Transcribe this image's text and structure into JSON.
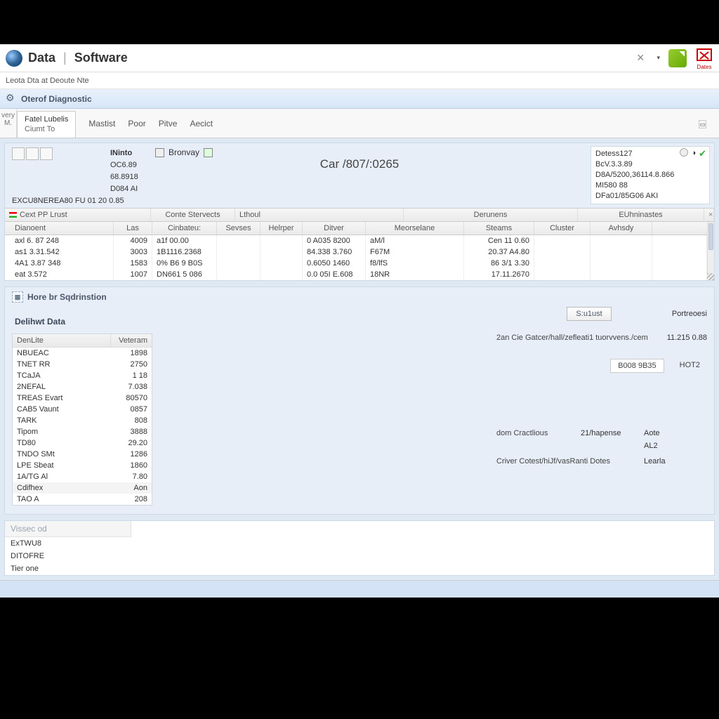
{
  "titlebar": {
    "app_a": "Data",
    "app_b": "Software",
    "badge_label": "Dates"
  },
  "subtitle": "Leota Dta at Deoute Nte",
  "section": {
    "title": "Oterof Diagnostic"
  },
  "side_stub": {
    "l1": "very",
    "l2": "M."
  },
  "tab": {
    "line1": "Fatel Lubelis",
    "line2": "Ciumt To"
  },
  "menu": {
    "m1": "Mastist",
    "m2": "Poor",
    "m3": "Pitve",
    "m4": "Aecict"
  },
  "info_left": {
    "hdr": "INinto",
    "v1": "OC6.89",
    "v2": "68.8918",
    "v3": "D084 AI"
  },
  "browse": {
    "label": "Bronvay"
  },
  "car_id": "Car /807/:0265",
  "info_bottom": "EXCU8NEREA80 FU 01 20 0.85",
  "info_right": {
    "l1": "Detess127",
    "l2": "BcV.3.3.89",
    "l3": "D8A/5200,36114.8.866",
    "l4": "MI580 88",
    "l5": "DFa01/85G06 AKI"
  },
  "header_cells": {
    "c1": "Cext PP Lrust",
    "c2": "Conte Stervects",
    "c3": "Lthoul",
    "c4": "Derunens",
    "c5": "EUhninastes"
  },
  "grid": {
    "cols": [
      "Dianoent",
      "Las",
      "Cinbateu:",
      "Sevses",
      "Helrper",
      "Ditver",
      "Meorselane",
      "Steams",
      "Cluster",
      "Avhsdy"
    ],
    "rows": [
      [
        "axl 6. 87 248",
        "4009",
        "a1f 00.00",
        "",
        "",
        "0 A035 8200",
        "aM/l",
        "Cen 11 0.60",
        "",
        ""
      ],
      [
        "as1 3.31.542",
        "3003",
        "1B1116.2368",
        "",
        "",
        "84.338 3.760",
        "F67M",
        "20.37 A4.80",
        "",
        ""
      ],
      [
        "4A1 3.87 348",
        "1583",
        "0% B6 9 B0S",
        "",
        "",
        "0.6050 1460",
        "f8/lfS",
        "86 3/1 3.30",
        "",
        ""
      ],
      [
        "eat 3.572",
        "1007",
        "DN661 5 086",
        "",
        "",
        "0.0 05I E.608",
        "18NR",
        "17.11.2670",
        "",
        ""
      ]
    ]
  },
  "subpanel": {
    "title": "Hore br Sqdrinstion"
  },
  "detail": {
    "title": "Delihwt Data",
    "head_k": "DenLite",
    "head_v": "Veteram",
    "rows": [
      [
        "NBUEAC",
        "1898"
      ],
      [
        "TNET RR",
        "2750"
      ],
      [
        "TCaJA",
        "1  18"
      ],
      [
        "2NEFAL",
        "7.038"
      ],
      [
        "TREAS Evart",
        "80570"
      ],
      [
        "CAB5 Vaunt",
        "0857"
      ],
      [
        "TARK",
        "808"
      ],
      [
        "Tipom",
        "3888"
      ],
      [
        "TD80",
        "29.20"
      ],
      [
        "TNDO SMt",
        "1286"
      ],
      [
        "LPE Sbeat",
        "1860"
      ],
      [
        "1A/TG Al",
        "7.80"
      ]
    ],
    "group_k": "Cdifhex",
    "group_v": "Aon",
    "tail_k": "TAO A",
    "tail_v": "208"
  },
  "right": {
    "btn1": "S:u1ust",
    "btn2": "Portreoesi",
    "line1_k": "2an Cie Gatcer/hall/zefleati1 tuorvvens./cem",
    "line1_v": "11.215 0.88",
    "chip1": "B008 9B35",
    "chip2": "HOT2",
    "r1_k": "dom Cractlious",
    "r1_v1": "21/hapense",
    "r1_v2": "Aote",
    "r2_v": "AL2",
    "r3_k": "Criver Cotest/hiJf/vasRanti Dotes",
    "r3_v": "Learla"
  },
  "footer": {
    "head": "Vissec od",
    "r1": "ExTWU8",
    "r2": "DITOFRE",
    "r3": "Tier one"
  }
}
